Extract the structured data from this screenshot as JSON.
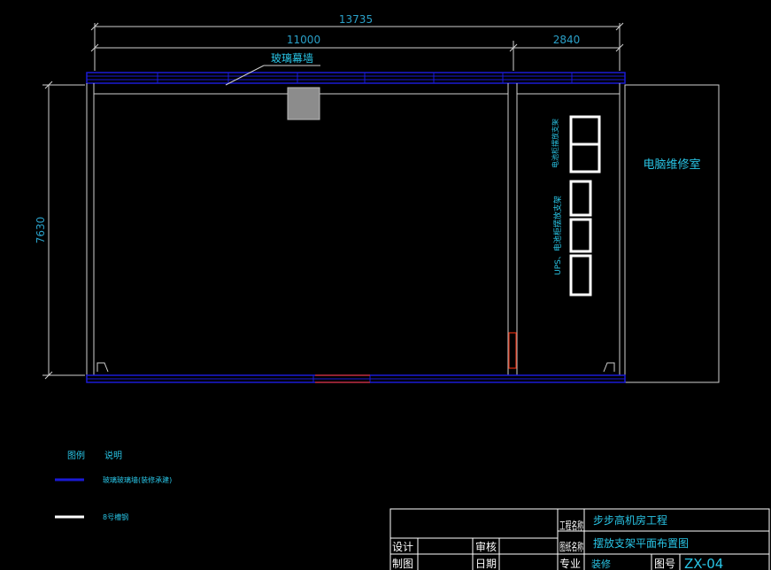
{
  "colors": {
    "background": "#000000",
    "wall_outline": "#cfcfcf",
    "glass_wall": "#1a1ad6",
    "dimension": "#2aa0c8",
    "label_cyan": "#29c5e6",
    "door_red": "#e03010",
    "rack_white": "#ffffff",
    "column_gray": "#8c8c8c",
    "title_block_line": "#ffffff"
  },
  "dimensions": {
    "total_width": "13735",
    "left_width": "11000",
    "right_width": "2840",
    "height": "7630"
  },
  "labels": {
    "glass_curtain_wall": "玻璃幕墙",
    "computer_repair_room": "电脑维修室",
    "rack_group_top": "电池柜摆放支架",
    "rack_group_bottom": "UPS、电池柜摆放支架"
  },
  "legend": {
    "header_symbol": "图例",
    "header_desc": "说明",
    "items": [
      {
        "desc": "玻璃玻璃墙(装修承建)",
        "color": "#1a1ad6"
      },
      {
        "desc": "8号槽钢",
        "color": "#ffffff"
      }
    ]
  },
  "title_block": {
    "project_name_label": "工程名称",
    "project_name": "步步高机房工程",
    "drawing_name_label": "图纸名称",
    "drawing_name": "摆放支架平面布置图",
    "design_label": "设计",
    "review_label": "审核",
    "draw_label": "制图",
    "date_label": "日期",
    "major_label": "专业",
    "major_value": "装修",
    "drawing_no_label": "图号",
    "drawing_no": "ZX-04"
  }
}
